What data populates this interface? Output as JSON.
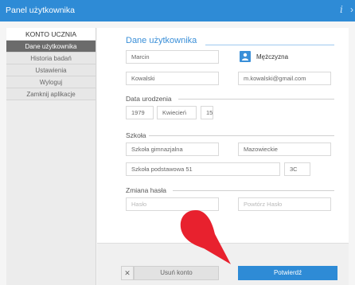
{
  "window": {
    "title": "Panel użytkownika",
    "info_glyph": "i",
    "more_glyph": "›"
  },
  "sidebar": {
    "header": "KONTO UCZNIA",
    "items": [
      {
        "label": "Dane użytkownika",
        "active": true
      },
      {
        "label": "Historia badań",
        "active": false
      },
      {
        "label": "Ustawienia",
        "active": false
      },
      {
        "label": "Wyloguj",
        "active": false
      },
      {
        "label": "Zamknij aplikacje",
        "active": false
      }
    ]
  },
  "form": {
    "section_title": "Dane użytkownika",
    "first_name": "Marcin",
    "last_name": "Kowalski",
    "email": "m.kowalski@gmail.com",
    "gender": {
      "icon": "person-icon",
      "label": "Mężczyzna"
    },
    "birth_label": "Data urodzenia",
    "birth_year": "1979",
    "birth_month": "Kwiecień",
    "birth_day": "15",
    "school_label": "Szkoła",
    "school_type": "Szkoła gimnazjalna",
    "region": "Mazowieckie",
    "school_name": "Szkoła podstawowa 51",
    "class": "3C",
    "password_label": "Zmiana hasła",
    "password_placeholder": "Hasło",
    "repeat_password_placeholder": "Powtórz Hasło"
  },
  "footer": {
    "close_glyph": "✕",
    "delete_label": "Usuń konto",
    "confirm_label": "Potwierdź"
  },
  "colors": {
    "accent": "#2e8bd6",
    "pointer": "#e8212e"
  }
}
